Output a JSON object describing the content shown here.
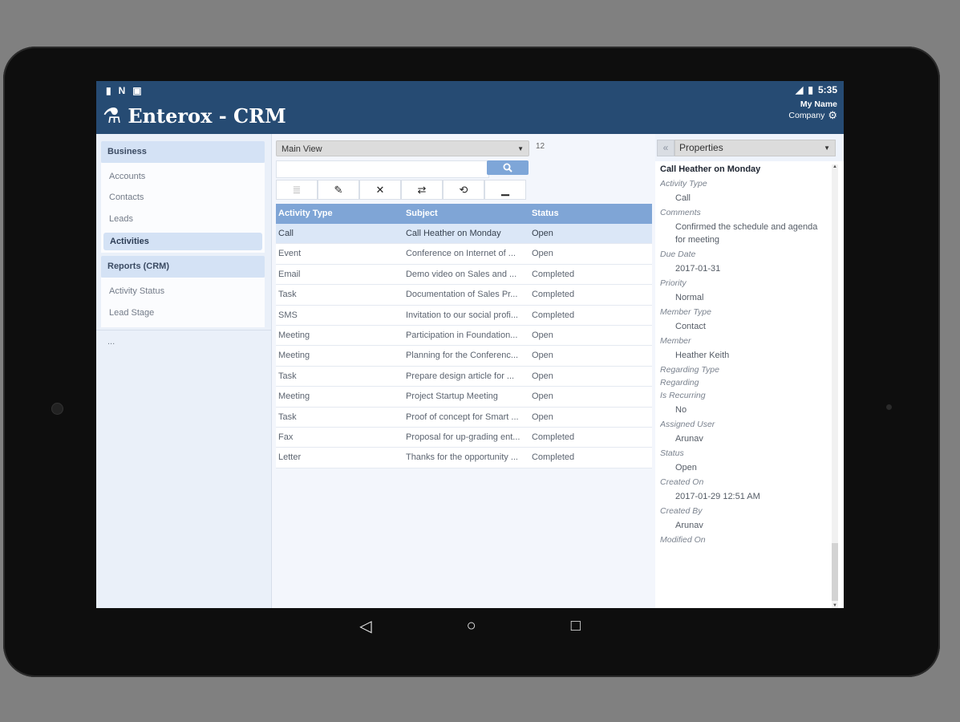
{
  "status_bar": {
    "left_icons": [
      "sim-icon",
      "nfc-icon",
      "download-icon"
    ],
    "time": "5:35"
  },
  "header": {
    "app_title": "Enterox - CRM",
    "user_name": "My Name",
    "company": "Company"
  },
  "sidebar": {
    "business_heading": "Business",
    "business_items": [
      {
        "label": "Accounts"
      },
      {
        "label": "Contacts"
      },
      {
        "label": "Leads"
      },
      {
        "label": "Activities",
        "active": true
      }
    ],
    "reports_heading": "Reports (CRM)",
    "reports_items": [
      {
        "label": "Activity Status"
      },
      {
        "label": "Lead Stage"
      }
    ],
    "footer_text": "..."
  },
  "main": {
    "view_select": "Main View",
    "record_count": "12",
    "search_placeholder": "",
    "toolbar_icons": [
      "list-icon",
      "edit-icon",
      "delete-icon",
      "assign-icon",
      "refresh-icon",
      "minimize-icon"
    ],
    "columns": [
      "Activity Type",
      "Subject",
      "Status"
    ],
    "rows": [
      [
        "Call",
        "Call Heather on Monday",
        "Open"
      ],
      [
        "Event",
        "Conference on Internet of ...",
        "Open"
      ],
      [
        "Email",
        "Demo video on Sales and ...",
        "Completed"
      ],
      [
        "Task",
        "Documentation of Sales Pr...",
        "Completed"
      ],
      [
        "SMS",
        "Invitation to our social profi...",
        "Completed"
      ],
      [
        "Meeting",
        "Participation in Foundation...",
        "Open"
      ],
      [
        "Meeting",
        "Planning for the Conferenc...",
        "Open"
      ],
      [
        "Task",
        "Prepare design article for ...",
        "Open"
      ],
      [
        "Meeting",
        "Project Startup Meeting",
        "Open"
      ],
      [
        "Task",
        "Proof of concept for Smart ...",
        "Open"
      ],
      [
        "Fax",
        "Proposal for up-grading ent...",
        "Completed"
      ],
      [
        "Letter",
        "Thanks for the opportunity ...",
        "Completed"
      ]
    ]
  },
  "properties": {
    "select_label": "Properties",
    "record_title": "Call Heather on Monday",
    "fields": [
      {
        "label": "Activity Type",
        "value": "Call"
      },
      {
        "label": "Comments",
        "value": "Confirmed the schedule and agenda for meeting"
      },
      {
        "label": "Due Date",
        "value": "2017-01-31"
      },
      {
        "label": "Priority",
        "value": "Normal"
      },
      {
        "label": "Member Type",
        "value": "Contact"
      },
      {
        "label": "Member",
        "value": "Heather Keith"
      },
      {
        "label": "Regarding Type",
        "value": ""
      },
      {
        "label": "Regarding",
        "value": ""
      },
      {
        "label": "Is Recurring",
        "value": "No"
      },
      {
        "label": "Assigned User",
        "value": "Arunav"
      },
      {
        "label": "Status",
        "value": "Open"
      },
      {
        "label": "Created On",
        "value": "2017-01-29 12:51 AM"
      },
      {
        "label": "Created By",
        "value": "Arunav"
      },
      {
        "label": "Modified On",
        "value": ""
      }
    ]
  },
  "colors": {
    "header_bg": "#264b73",
    "grid_header_bg": "#7fa5d6",
    "search_button_bg": "#7ea6d8",
    "selected_row_bg": "#dbe7f7",
    "nav_section_bg": "#d4e2f5"
  }
}
